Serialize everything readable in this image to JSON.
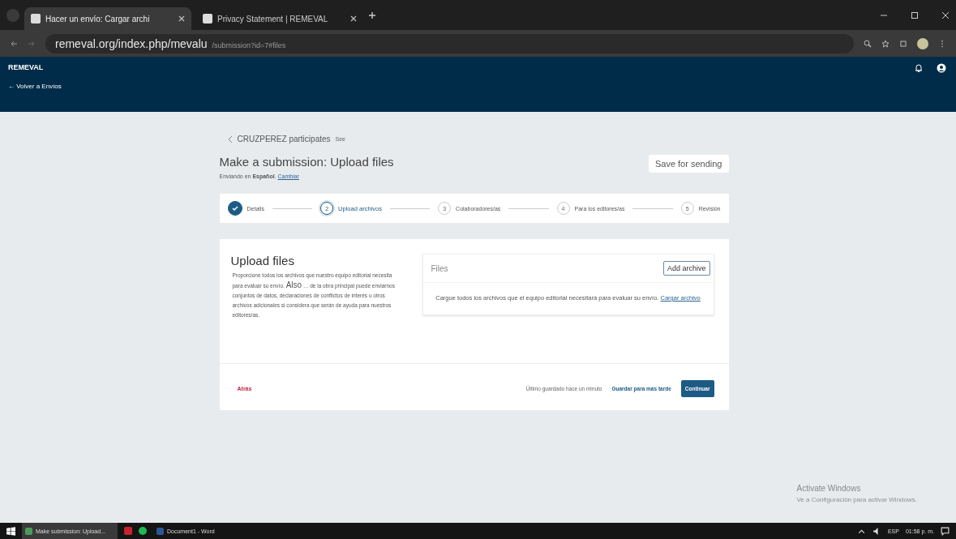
{
  "browser": {
    "tabs": [
      {
        "title": "Hacer un envío: Cargar archi",
        "selected": true
      },
      {
        "title": "Privacy Statement | REMEVAL",
        "selected": false
      }
    ],
    "url": "remeval.org/index.php/mevalu",
    "url_rest": "/submission?id=7#files"
  },
  "header": {
    "site": "REMEVAL",
    "back_link": "← Volver a Envíos"
  },
  "breadcrumb": {
    "text": "CRUZPEREZ participates",
    "tag": "See"
  },
  "page": {
    "title": "Make a submission: Upload files",
    "save_button": "Save for sending",
    "language_prefix": "Enviando en **Español**.",
    "language_link": "Cambiar"
  },
  "steps": [
    {
      "label": "Details",
      "completed": true,
      "selected": false
    },
    {
      "number": "2",
      "label": "Upload archivos",
      "completed": false,
      "selected": true
    },
    {
      "number": "3",
      "label": "Colaboradores/as",
      "completed": false,
      "selected": false
    },
    {
      "number": "4",
      "label": "Para los editores/as",
      "completed": false,
      "selected": false
    },
    {
      "number": "5",
      "label": "Revisión",
      "completed": false,
      "selected": false
    }
  ],
  "upload": {
    "title": "Upload files",
    "intro": "Proporcione todos los archivos que nuestro equipo editorial necesita para evaluar su envío.",
    "also": "Also",
    "intro_rest": "… de la obra principal puede enviarnos conjuntos de datos, declaraciones de conflictos de interés u otros archivos adicionales si considera que serán de ayuda para nuestros editores/as.",
    "files_title": "Files",
    "add_button": "Add archive",
    "empty_message": "Cargue todos los archivos que el equipo editorial necesitará para evaluar su envío.",
    "empty_link": "Cargar archivo"
  },
  "footer": {
    "back": "Atrás",
    "last_saved": "Último guardado hace un minuto",
    "save_later": "Guardar para más tarde",
    "continue": "Continuar"
  },
  "activation": {
    "title": "Activate Windows",
    "hint": "Ve a Configuración para activar Windows."
  },
  "taskbar": {
    "apps": [
      "Make submission: Upload...",
      "Document1 - Word"
    ],
    "language": "ESP",
    "time": "01:58 p. m."
  }
}
